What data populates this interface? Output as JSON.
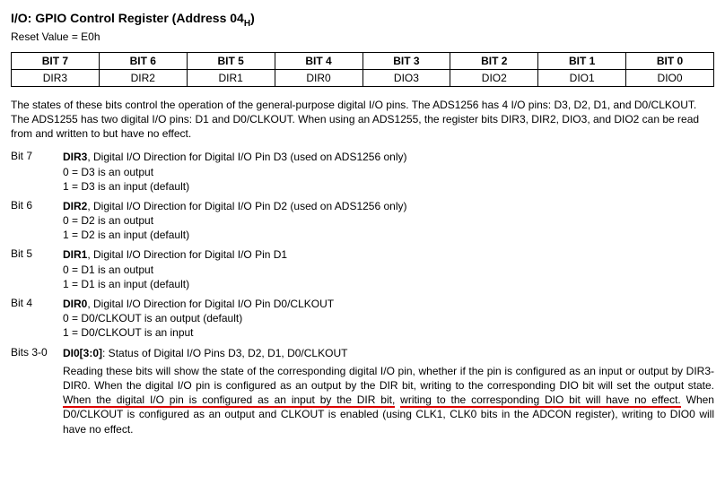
{
  "title_prefix": "I/O: GPIO Control Register (Address 04",
  "title_sub": "H",
  "title_suffix": ")",
  "reset_value": "Reset Value = E0h",
  "bit_headers": [
    "BIT 7",
    "BIT 6",
    "BIT 5",
    "BIT 4",
    "BIT 3",
    "BIT 2",
    "BIT 1",
    "BIT 0"
  ],
  "bit_names": [
    "DIR3",
    "DIR2",
    "DIR1",
    "DIR0",
    "DIO3",
    "DIO2",
    "DIO1",
    "DIO0"
  ],
  "intro": "The states of these bits control the operation of the general-purpose digital I/O pins. The ADS1256 has 4 I/O pins: D3, D2, D1, and D0/CLKOUT. The ADS1255 has two digital I/O pins: D1 and D0/CLKOUT. When using an ADS1255, the register bits DIR3, DIR2, DIO3, and DIO2 can be read from and written to but have no effect.",
  "bits": {
    "b7": {
      "label": "Bit 7",
      "name": "DIR3",
      "desc": ", Digital I/O Direction for Digital I/O Pin D3 (used on ADS1256 only)",
      "l0": "0 = D3 is an output",
      "l1": "1 = D3 is an input (default)"
    },
    "b6": {
      "label": "Bit 6",
      "name": "DIR2",
      "desc": ", Digital I/O Direction for Digital I/O Pin D2 (used on ADS1256 only)",
      "l0": "0 = D2 is an output",
      "l1": "1 = D2 is an input (default)"
    },
    "b5": {
      "label": "Bit 5",
      "name": "DIR1",
      "desc": ", Digital I/O Direction for Digital I/O Pin D1",
      "l0": "0 = D1 is an output",
      "l1": "1 = D1 is an input (default)"
    },
    "b4": {
      "label": "Bit 4",
      "name": "DIR0",
      "desc": ", Digital I/O Direction for Digital I/O Pin D0/CLKOUT",
      "l0": "0 = D0/CLKOUT is an output (default)",
      "l1": "1 = D0/CLKOUT is an input"
    },
    "b30": {
      "label": "Bits 3-0",
      "name": "DI0[3:0]",
      "desc": ": Status of Digital I/O Pins D3, D2, D1, D0/CLKOUT",
      "para_a": "Reading these bits will show the state of the corresponding digital I/O pin, whether if the pin is configured as an input or output by DIR3-DIR0. When the digital I/O pin is configured as an output by the DIR bit, writing to the corresponding DIO bit will set the output state. ",
      "underline1": "When the digital I/O pin is configured as an input by the DIR bit,",
      "underline2": "writing to the corresponding DIO bit will have no effect.",
      "para_b": " When D0/CLKOUT is configured as an output and CLKOUT is enabled (using CLK1, CLK0 bits in the ADCON register), writing to DIO0 will have no effect."
    }
  }
}
